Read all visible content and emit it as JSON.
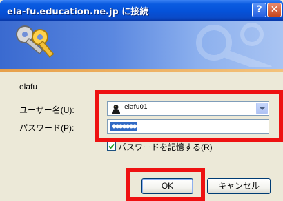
{
  "window": {
    "title": "ela-fu.education.ne.jp に接続",
    "help_button": "?",
    "close_button": "✕"
  },
  "banner": {
    "icon": "keys-icon",
    "accent_color": "#e7a04a",
    "gradient_colors": [
      "#3a6ad0",
      "#a9c4f2"
    ]
  },
  "form": {
    "server_label": "elafu",
    "username_label": "ユーザー名(U):",
    "username_value": "elafu01",
    "username_icon": "user-icon",
    "password_label": "パスワード(P):",
    "password_value": "●●●●●●●",
    "remember_label": "パスワードを記憶する(R)",
    "remember_checked": true
  },
  "buttons": {
    "ok_label": "OK",
    "cancel_label": "キャンセル"
  },
  "highlights": {
    "color": "#ee1111"
  }
}
